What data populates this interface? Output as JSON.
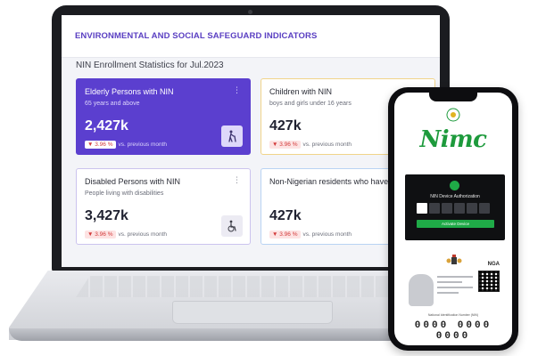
{
  "dashboard": {
    "header_title": "ENVIRONMENTAL AND SOCIAL SAFEGUARD INDICATORS",
    "section_title": "NIN Enrollment Statistics for Jul.2023",
    "cards": [
      {
        "title": "Elderly Persons with NIN",
        "subtitle": "65 years and above",
        "value": "2,427k",
        "change": "3.96 %",
        "change_note": "vs. previous month",
        "icon": "elderly-person-icon"
      },
      {
        "title": "Children with NIN",
        "subtitle": "boys and girls under 16 years",
        "value": "427k",
        "change": "3.96 %",
        "change_note": "vs. previous month"
      },
      {
        "title": "Disabled Persons with NIN",
        "subtitle": "People living with disabilities",
        "value": "3,427k",
        "change": "3.96 %",
        "change_note": "vs. previous month",
        "icon": "wheelchair-icon"
      },
      {
        "title": "Non-Nigerian residents who have a",
        "subtitle": "",
        "value": "427k",
        "change": "3.96 %",
        "change_note": "vs. previous month"
      }
    ]
  },
  "phone": {
    "logo": "Nimc",
    "auth_title": "NIN Device Authorization",
    "activate_label": "Activate Device",
    "id_card": {
      "country_code": "NGA",
      "nin_label": "National Identification Number (NIN)",
      "nin_value": "0000 0000 0000"
    }
  },
  "colors": {
    "primary_purple": "#5b3fcf",
    "nimc_green": "#1d9a3c",
    "decrease_red": "#d33b3b"
  }
}
